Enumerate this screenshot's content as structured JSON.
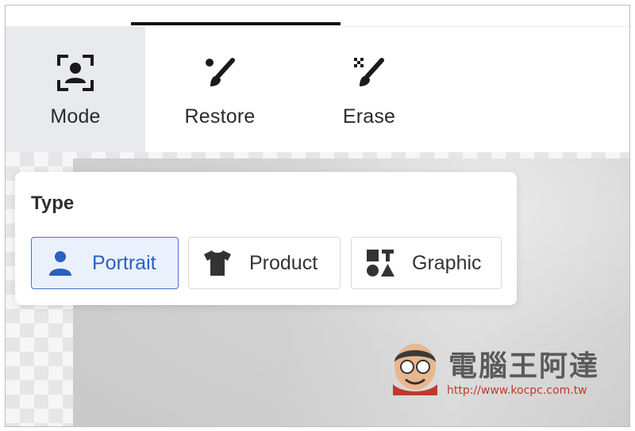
{
  "toolbar": {
    "tools": [
      {
        "label": "Mode",
        "icon": "portrait-focus-icon",
        "active": true
      },
      {
        "label": "Restore",
        "icon": "brush-icon",
        "active": false
      },
      {
        "label": "Erase",
        "icon": "eraser-brush-icon",
        "active": false
      }
    ]
  },
  "type_panel": {
    "title": "Type",
    "options": [
      {
        "label": "Portrait",
        "icon": "person-icon",
        "selected": true
      },
      {
        "label": "Product",
        "icon": "tshirt-icon",
        "selected": false
      },
      {
        "label": "Graphic",
        "icon": "shapes-icon",
        "selected": false
      }
    ]
  },
  "watermark": {
    "text": "電腦王阿達",
    "url": "http://www.kocpc.com.tw"
  },
  "colors": {
    "accent": "#3b73d6",
    "selected_bg": "#eaf1fd",
    "active_tool_bg": "#e9eaed",
    "text": "#2b2b2b"
  }
}
